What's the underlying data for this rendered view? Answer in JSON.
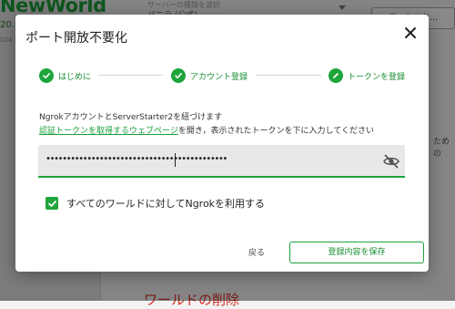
{
  "background": {
    "logo": "NewWorld",
    "version": "20.",
    "date": "024",
    "select_label": "サーバーの種類を選択",
    "select_value": "バニラ (公式)",
    "right_button": "ワールドを…",
    "side_text": "ための",
    "danger_heading": "ワールドの削除"
  },
  "dialog": {
    "title": "ポート開放不要化",
    "steps": [
      {
        "label": "はじめに",
        "state": "done",
        "icon": "check-icon"
      },
      {
        "label": "アカウント登録",
        "state": "done",
        "icon": "check-icon"
      },
      {
        "label": "トークンを登録",
        "state": "active",
        "icon": "pencil-icon"
      }
    ],
    "description_line1": "NgrokアカウントとServerStarter2を紐づけます",
    "description_link": "認証トークンを取得するウェブページ",
    "description_line2_rest": "を開き，表示されたトークンを下に入力してください",
    "token_value": "••••••••••••••••••••••••••••••••••••••••••••",
    "checkbox_label": "すべてのワールドに対してNgrokを利用する",
    "checkbox_checked": true,
    "back_label": "戻る",
    "save_label": "登録内容を保存"
  },
  "colors": {
    "accent": "#1ea53c",
    "accent_text": "#1a8f35",
    "danger": "#d93025"
  }
}
